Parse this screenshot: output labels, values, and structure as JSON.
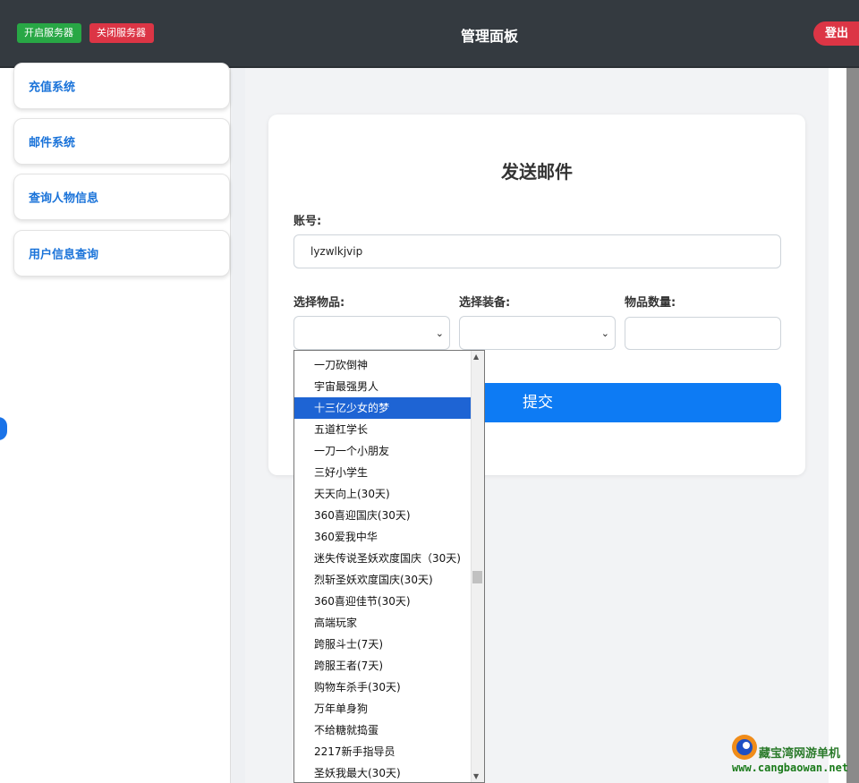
{
  "header": {
    "start_server": "开启服务器",
    "stop_server": "关闭服务器",
    "title": "管理面板",
    "logout": "登出"
  },
  "sidebar": {
    "items": [
      {
        "label": "充值系统"
      },
      {
        "label": "邮件系统"
      },
      {
        "label": "查询人物信息"
      },
      {
        "label": "用户信息查询"
      }
    ]
  },
  "form": {
    "title": "发送邮件",
    "account_label": "账号:",
    "account_value": "lyzwlkjvip",
    "item_label": "选择物品:",
    "equipment_label": "选择装备:",
    "quantity_label": "物品数量:",
    "submit_label": "提交"
  },
  "dropdown": {
    "options": [
      "一刀砍倒神",
      "宇宙最强男人",
      "十三亿少女的梦",
      "五道杠学长",
      "一刀一个小朋友",
      "三好小学生",
      "天天向上(30天)",
      "360喜迎国庆(30天)",
      "360爱我中华",
      "迷失传说圣妖欢度国庆（30天)",
      "烈斩圣妖欢度国庆(30天)",
      "360喜迎佳节(30天)",
      "高端玩家",
      "跨服斗士(7天)",
      "跨服王者(7天)",
      "购物车杀手(30天)",
      "万年单身狗",
      "不给糖就捣蛋",
      "2217新手指导员",
      "圣妖我最大(30天)"
    ],
    "highlighted": "十三亿少女的梦"
  },
  "watermark": {
    "name": "藏宝湾网游单机",
    "url": "www.cangbaowan.net"
  },
  "colors": {
    "header_bg": "#343a40",
    "start_green": "#28a745",
    "stop_red": "#dc3545",
    "submit_blue": "#0d7bf4",
    "link_blue": "#1a73d9",
    "highlight": "#1e64d4"
  }
}
